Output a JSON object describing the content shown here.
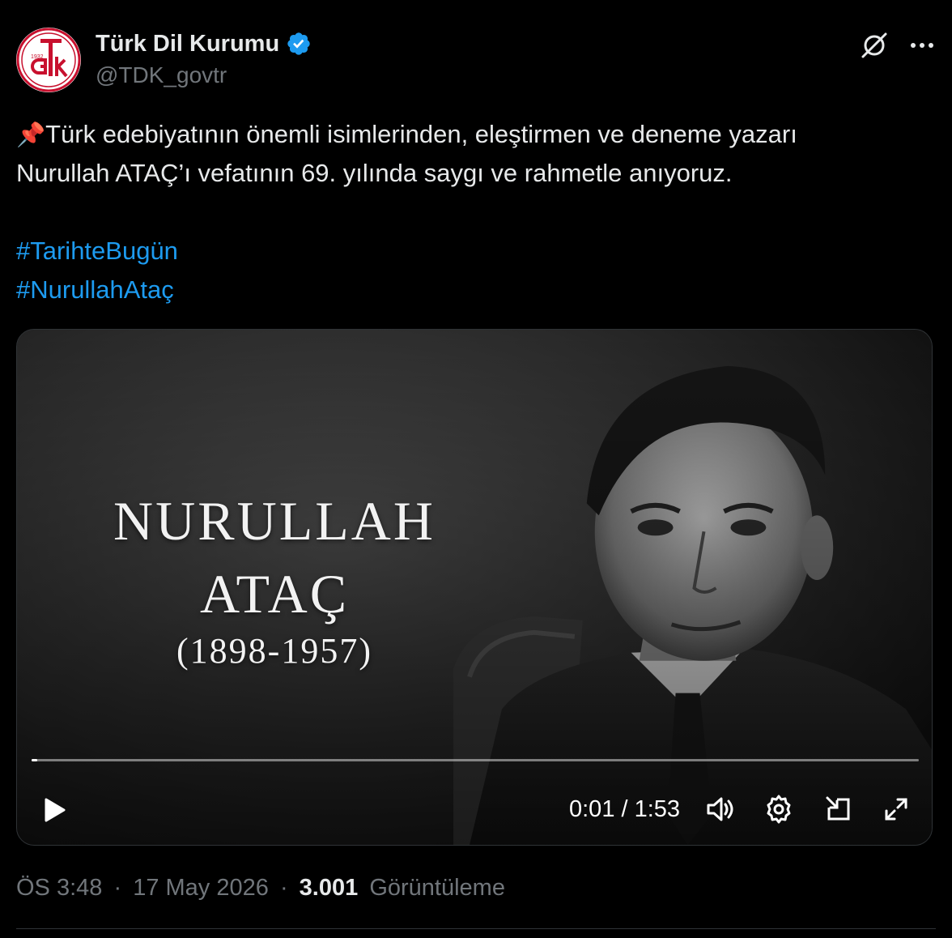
{
  "author": {
    "display_name": "Türk Dil Kurumu",
    "handle": "@TDK_govtr",
    "verified": true,
    "avatar": {
      "year": "1932",
      "letters": "TDK"
    }
  },
  "icons": {
    "verified": "verified-badge-icon",
    "grok": "grok-icon",
    "more": "more-icon",
    "pin": "pushpin-icon"
  },
  "tweet": {
    "pin_emoji": "📌",
    "line1": "Türk edebiyatının önemli isimlerinden, eleştirmen ve deneme yazarı",
    "line2": "Nurullah ATAÇ’ı vefatının 69. yılında saygı ve rahmetle anıyoruz.",
    "hashtags": [
      "#TarihteBugün",
      "#NurullahAtaç"
    ]
  },
  "video": {
    "overlay_line1": "NURULLAH",
    "overlay_line2": "ATAÇ",
    "overlay_line3": "(1898-1957)",
    "time_display": "0:01 / 1:53",
    "progress_fraction": 0.006
  },
  "meta": {
    "time": "ÖS 3:48",
    "separator": "·",
    "date": "17 May 2026",
    "views_count": "3.001",
    "views_label": "Görüntüleme"
  },
  "colors": {
    "background": "#000000",
    "text": "#e7e9ea",
    "muted": "#71767b",
    "link": "#1d9bf0",
    "verified": "#1d9bf0",
    "logo_red": "#c8102e"
  }
}
